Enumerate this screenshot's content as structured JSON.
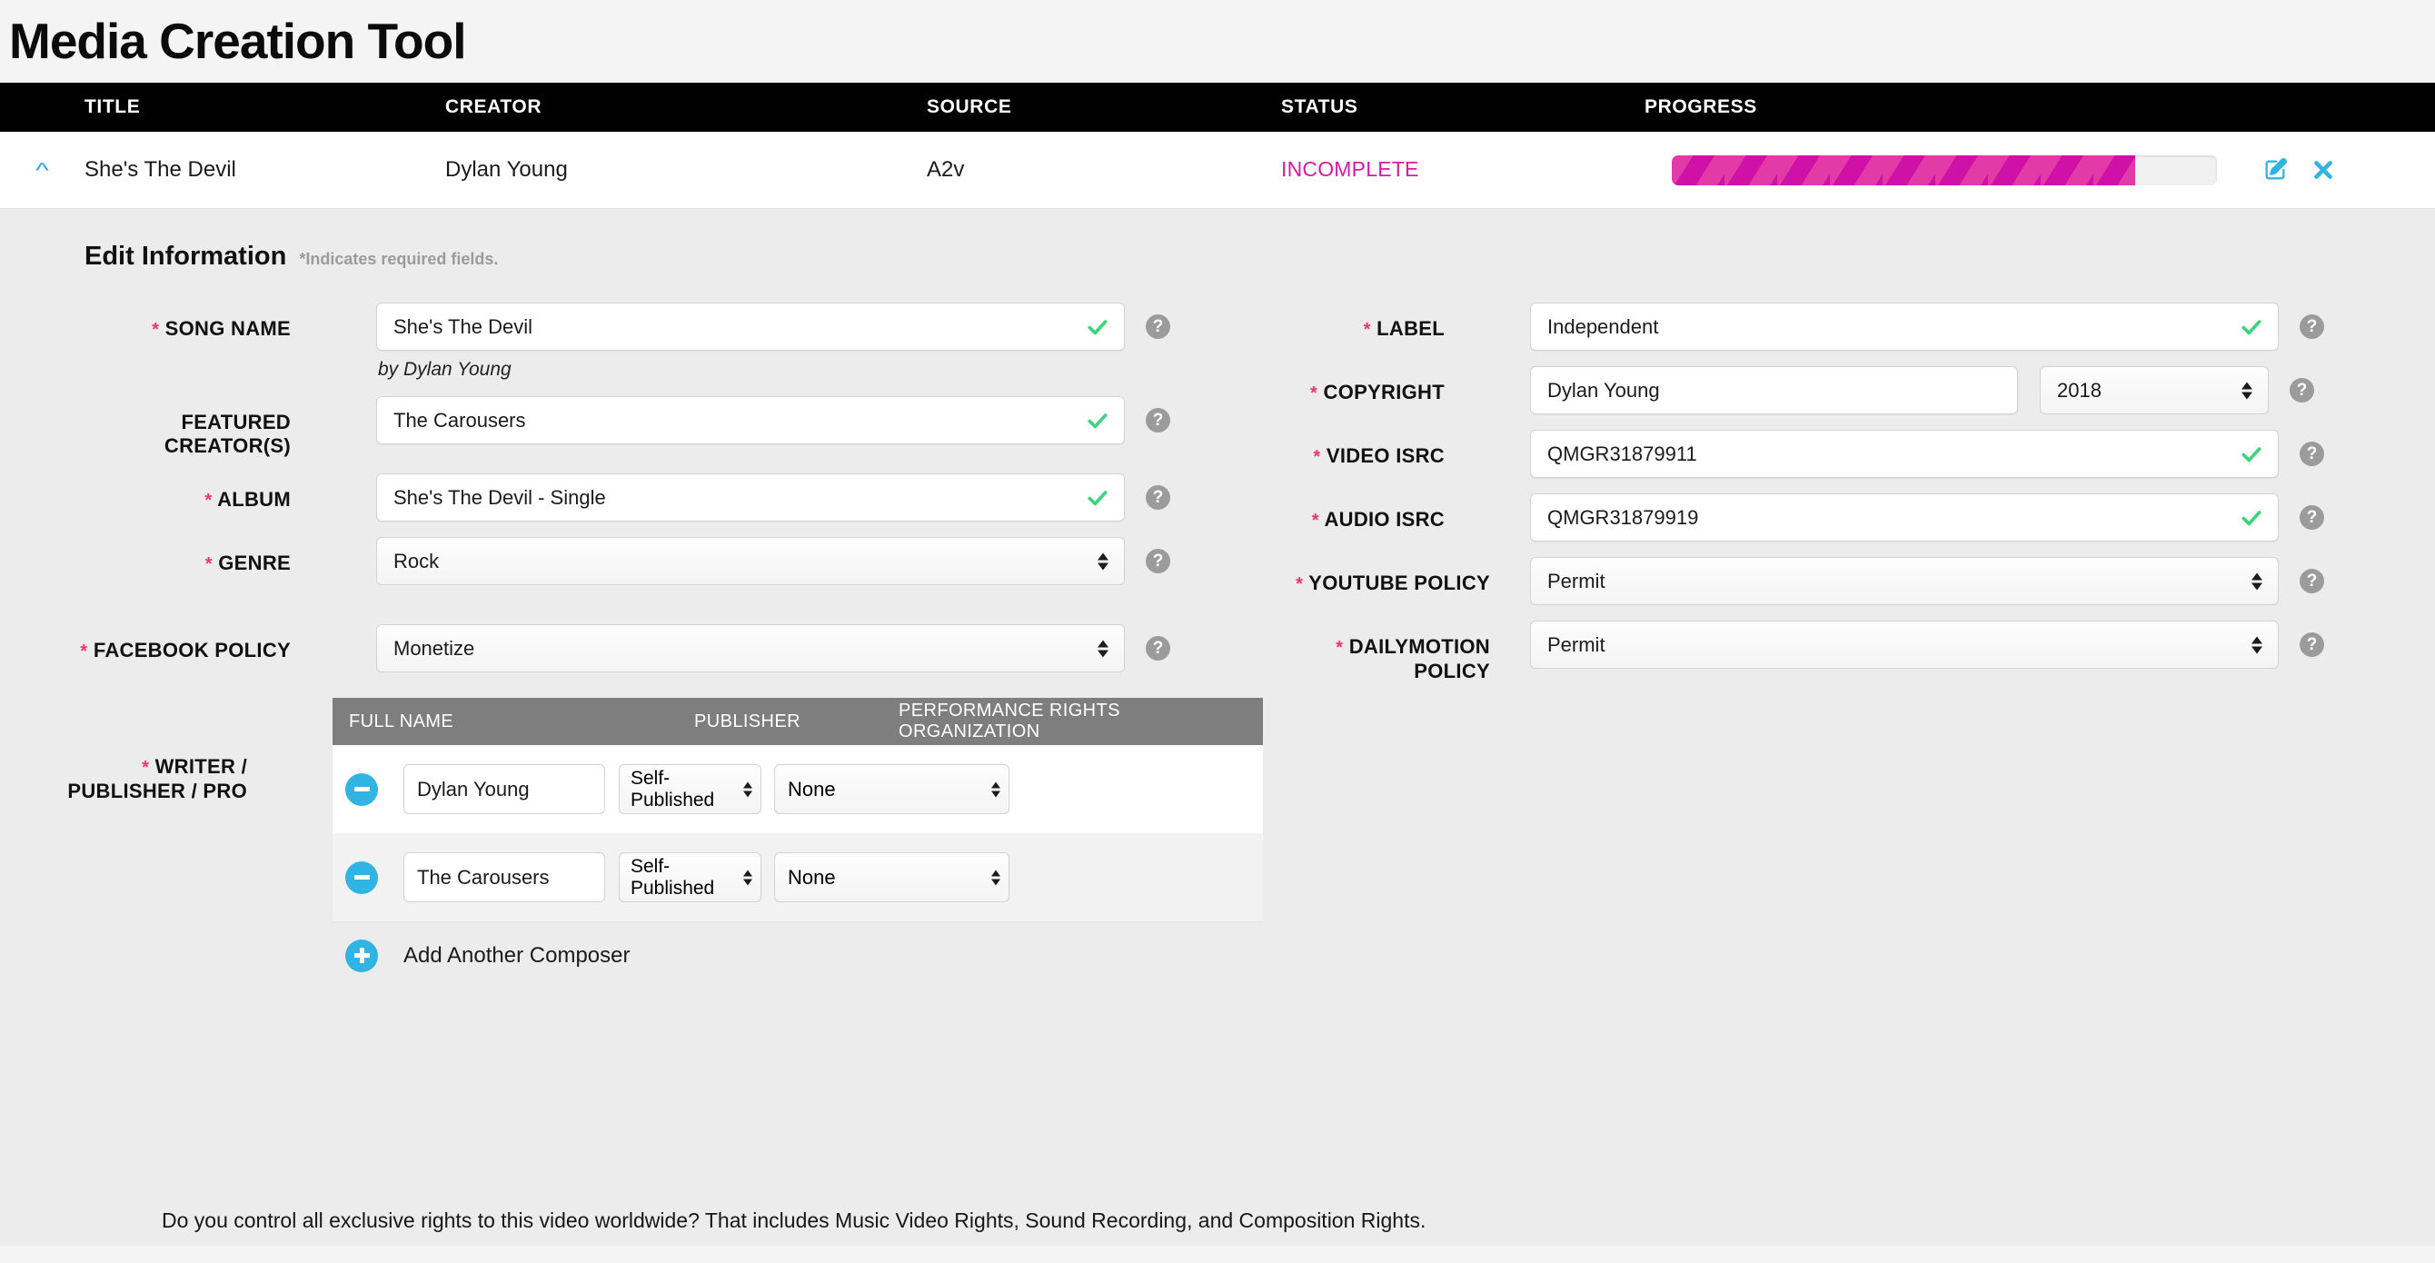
{
  "page": {
    "title": "Media Creation Tool"
  },
  "table": {
    "columns": [
      "TITLE",
      "CREATOR",
      "SOURCE",
      "STATUS",
      "PROGRESS"
    ],
    "row": {
      "chevron": "collapse-chevron-up",
      "title": "She's The Devil",
      "creator": "Dylan Young",
      "source": "A2v",
      "status": "INCOMPLETE",
      "status_color": "#d61aa3",
      "progress_percent": 85,
      "progress_color": "#d011a8",
      "progress_stripe_color": "#e23aa7",
      "actions": {
        "edit_icon": "edit-pencil-square-icon",
        "close_icon": "close-x-icon",
        "icon_color": "#2fb4e3"
      }
    }
  },
  "edit_panel": {
    "heading": "Edit Information",
    "required_note": "*Indicates required fields.",
    "left_fields": {
      "song_name": {
        "label": "SONG NAME",
        "required": true,
        "value": "She's The Devil",
        "valid": true,
        "byline": "by Dylan Young"
      },
      "featured_creators": {
        "label_line1": "FEATURED",
        "label_line2": "CREATOR(S)",
        "required": false,
        "value": "The Carousers",
        "valid": true
      },
      "album": {
        "label": "ALBUM",
        "required": true,
        "value": "She's The Devil - Single",
        "valid": true
      },
      "genre": {
        "label": "GENRE",
        "required": true,
        "value": "Rock",
        "type": "select"
      },
      "facebook_policy": {
        "label": "FACEBOOK POLICY",
        "required": true,
        "value": "Monetize",
        "type": "select"
      },
      "writer_block": {
        "label_line1": "WRITER /",
        "label_line2": "PUBLISHER / PRO",
        "required": true
      }
    },
    "right_fields": {
      "label_field": {
        "label": "LABEL",
        "required": true,
        "value": "Independent",
        "valid": true
      },
      "copyright": {
        "label": "COPYRIGHT",
        "required": true,
        "value": "Dylan Young",
        "year": "2018"
      },
      "video_isrc": {
        "label": "VIDEO ISRC",
        "required": true,
        "value": "QMGR31879911",
        "valid": true
      },
      "audio_isrc": {
        "label": "AUDIO ISRC",
        "required": true,
        "value": "QMGR31879919",
        "valid": true
      },
      "youtube_policy": {
        "label": "YOUTUBE POLICY",
        "required": true,
        "value": "Permit",
        "type": "select"
      },
      "dailymotion_policy": {
        "label_line1": "DAILYMOTION",
        "label_line2": "POLICY",
        "required": true,
        "value": "Permit",
        "type": "select"
      }
    },
    "composer_table": {
      "columns": [
        "FULL NAME",
        "PUBLISHER",
        "PERFORMANCE RIGHTS ORGANIZATION"
      ],
      "rows": [
        {
          "remove_icon": "minus-circle-icon",
          "full_name": "Dylan Young",
          "publisher": "Self-Published",
          "pro": "None"
        },
        {
          "remove_icon": "minus-circle-icon",
          "full_name": "The Carousers",
          "publisher": "Self-Published",
          "pro": "None"
        }
      ],
      "add_icon": "plus-circle-icon",
      "add_label": "Add Another Composer"
    },
    "bottom_question": "Do you control all exclusive rights to this video worldwide? That includes Music Video Rights, Sound Recording, and Composition Rights."
  },
  "icons": {
    "help": "?",
    "check": "check-mark-icon"
  }
}
